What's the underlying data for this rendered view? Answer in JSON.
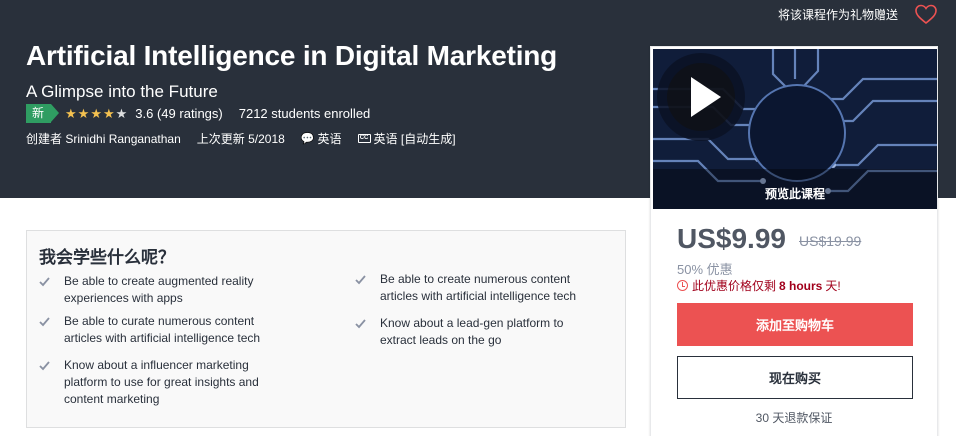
{
  "header": {
    "gift_label": "将该课程作为礼物赠送",
    "wishlist_icon": "heart-icon"
  },
  "course": {
    "title": "Artificial Intelligence in Digital Marketing",
    "subtitle": "A Glimpse into the Future",
    "badge": "新",
    "rating_value": 3.6,
    "rating_max": 5,
    "rating_text": "3.6 (49 ratings)",
    "students": "7212 students enrolled",
    "creator": "创建者 Srinidhi Ranganathan",
    "last_updated": "上次更新 5/2018",
    "language": "英语",
    "captions": "英语 [自动生成]",
    "caption_icon_text": "CC"
  },
  "sidebar": {
    "preview_label": "预览此课程",
    "price": "US$9.99",
    "original_price": "US$19.99",
    "discount": "50% 优惠",
    "countdown_prefix": "此优惠价格仅剩",
    "countdown_time": "8 hours",
    "countdown_suffix": "天!",
    "add_to_cart": "添加至购物车",
    "buy_now": "现在购买",
    "guarantee": "30 天退款保证"
  },
  "learn": {
    "title": "我会学些什么呢？",
    "items": [
      "Be able to create augmented reality experiences with apps",
      "Be able to create numerous content articles with artificial intelligence tech",
      "Be able to curate numerous content articles with artificial intelligence tech",
      "Know about a lead-gen platform to extract leads on the go",
      "Know about a influencer marketing platform to use for great insights and content marketing"
    ]
  },
  "colors": {
    "hero_bg": "#29303b",
    "accent_red": "#ec5252",
    "star": "#f4c150",
    "badge_green": "#2f9d62",
    "countdown": "#a1001b"
  }
}
